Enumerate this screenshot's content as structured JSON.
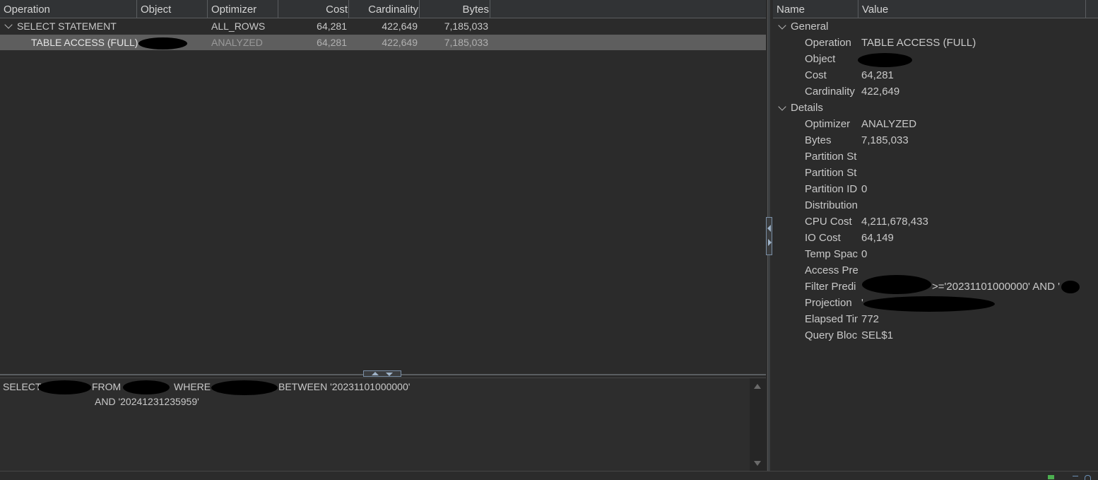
{
  "plan": {
    "columns": [
      "Operation",
      "Object",
      "Optimizer",
      "Cost",
      "Cardinality",
      "Bytes"
    ],
    "rows": [
      {
        "operation": "SELECT STATEMENT",
        "optimizer": "ALL_ROWS",
        "cost": "64,281",
        "cardinality": "422,649",
        "bytes": "7,185,033"
      },
      {
        "operation": "TABLE ACCESS (FULL)",
        "optimizer": "ANALYZED",
        "cost": "64,281",
        "cardinality": "422,649",
        "bytes": "7,185,033"
      }
    ]
  },
  "props": {
    "columns": [
      "Name",
      "Value"
    ],
    "general_label": "General",
    "details_label": "Details",
    "general": [
      {
        "name": "Operation",
        "value": "TABLE ACCESS (FULL)"
      },
      {
        "name": "Object",
        "value": ""
      },
      {
        "name": "Cost",
        "value": "64,281"
      },
      {
        "name": "Cardinality",
        "value": "422,649"
      }
    ],
    "details": [
      {
        "name": "Optimizer",
        "value": "ANALYZED"
      },
      {
        "name": "Bytes",
        "value": "7,185,033"
      },
      {
        "name": "Partition St",
        "value": ""
      },
      {
        "name": "Partition St",
        "value": ""
      },
      {
        "name": "Partition ID",
        "value": "0"
      },
      {
        "name": "Distribution",
        "value": ""
      },
      {
        "name": "CPU Cost",
        "value": "4,211,678,433"
      },
      {
        "name": "IO Cost",
        "value": "64,149"
      },
      {
        "name": "Temp Space",
        "value": "0"
      },
      {
        "name": "Access Pred",
        "value": ""
      },
      {
        "name": "Filter Predi",
        "value": ">='20231101000000' AND '"
      },
      {
        "name": "Projection",
        "value": "'"
      },
      {
        "name": "Elapsed Tim",
        "value": "772"
      },
      {
        "name": "Query Block",
        "value": "SEL$1"
      }
    ]
  },
  "sql": {
    "select_kw": "SELECT",
    "from_kw": "FROM",
    "where_kw": "WHERE",
    "between_text": "BETWEEN '20231101000000'",
    "line2": "AND '20241231235959'"
  }
}
